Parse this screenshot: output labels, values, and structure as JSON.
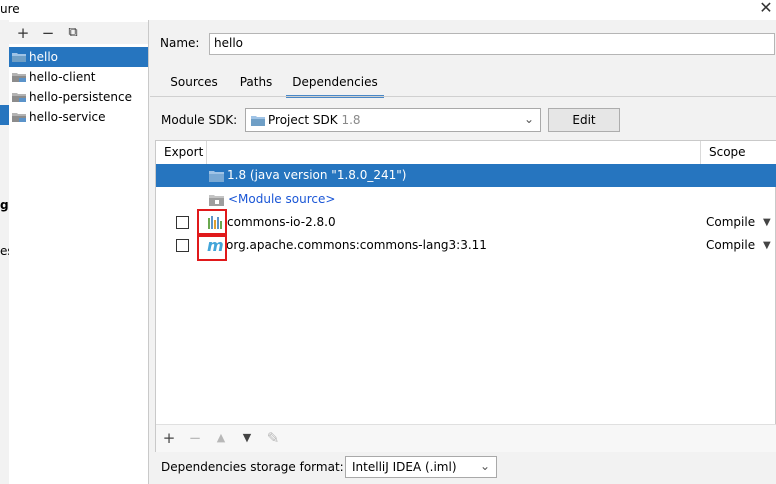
{
  "window": {
    "title_fragment": "ure",
    "close_glyph": "✕"
  },
  "left_strip": {
    "frag1": "gs",
    "frag2": "es"
  },
  "modules_toolbar": {
    "add": "+",
    "remove": "−",
    "copy": "⧉"
  },
  "modules": [
    {
      "label": "hello",
      "selected": true
    },
    {
      "label": "hello-client",
      "selected": false
    },
    {
      "label": "hello-persistence",
      "selected": false
    },
    {
      "label": "hello-service",
      "selected": false
    }
  ],
  "name_field": {
    "label": "Name:",
    "value": "hello"
  },
  "tabs": [
    {
      "label": "Sources",
      "active": false
    },
    {
      "label": "Paths",
      "active": false
    },
    {
      "label": "Dependencies",
      "active": true
    }
  ],
  "module_sdk": {
    "label": "Module SDK:",
    "value": "Project SDK",
    "version": "1.8",
    "edit_label": "Edit"
  },
  "dependencies": {
    "columns": {
      "export": "Export",
      "scope": "Scope"
    },
    "rows": [
      {
        "name": "1.8 (java version \"1.8.0_241\")",
        "icon": "jdk-folder-icon",
        "selected": true
      },
      {
        "name": "<Module source>",
        "icon": "module-source-folder-icon",
        "selected": false
      },
      {
        "name": "commons-io-2.8.0",
        "icon": "library-icon",
        "scope": "Compile",
        "export": false
      },
      {
        "name": "org.apache.commons:commons-lang3:3.11",
        "icon": "maven-icon",
        "scope": "Compile",
        "export": false
      }
    ],
    "toolbar": {
      "add": "+",
      "remove": "−",
      "up": "▲",
      "down": "▼",
      "edit": "✎"
    }
  },
  "storage_format": {
    "label": "Dependencies storage format:",
    "value": "IntelliJ IDEA (.iml)"
  },
  "colors": {
    "selection": "#2675bf",
    "highlight": "#e0191b",
    "link": "#1a56d6",
    "folder": "#6f9fc6"
  }
}
